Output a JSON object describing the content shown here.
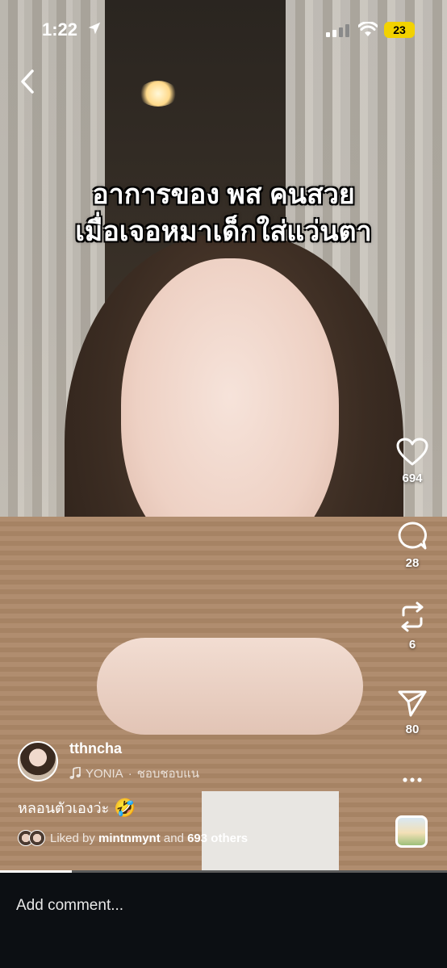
{
  "status_bar": {
    "time": "1:22",
    "battery": "23"
  },
  "video": {
    "caption_line1": "อาการของ พส คนสวย",
    "caption_line2": "เมื่อเจอหมาเด็กใส่แว่นตา",
    "progress": 0.16
  },
  "actions": {
    "likes": "694",
    "comments": "28",
    "reposts": "6",
    "shares": "80"
  },
  "author": {
    "username": "tthncha",
    "music_artist": "YONIA",
    "music_separator": " · ",
    "music_title": "ชอบชอบแน"
  },
  "post": {
    "caption": "หลอนตัวเองว่ะ",
    "emoji": "🤣",
    "liked_prefix": "Liked by ",
    "liked_user": "mintnmynt",
    "liked_middle": " and ",
    "liked_others": "693 others"
  },
  "comment": {
    "placeholder": "Add comment..."
  },
  "colors": {
    "battery": "#f2d200",
    "comment_bar": "#0c0f13"
  }
}
